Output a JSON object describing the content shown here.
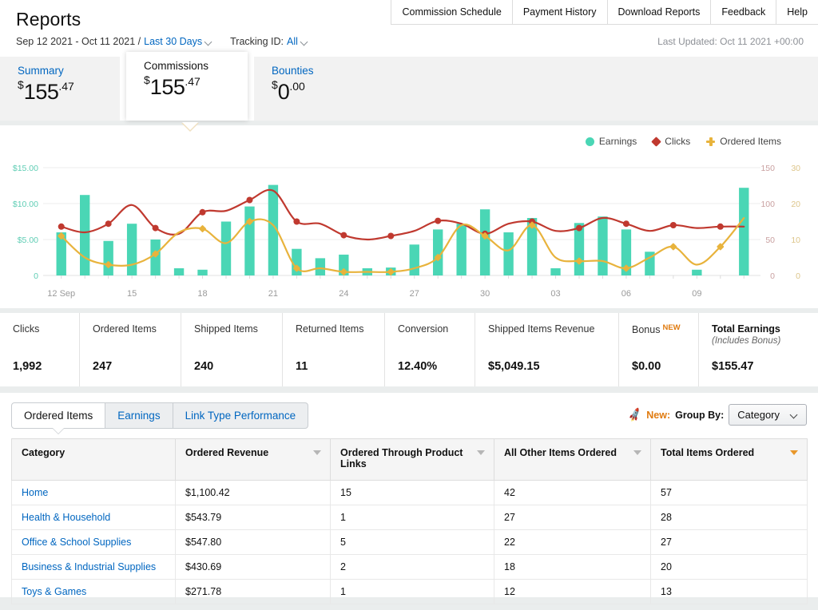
{
  "header": {
    "title": "Reports",
    "date_range": "Sep 12 2021 - Oct 11 2021 /",
    "range_preset": "Last 30 Days",
    "tracking_label": "Tracking ID:",
    "tracking_value": "All",
    "last_updated": "Last Updated: Oct 11 2021 +00:00",
    "nav": [
      {
        "label": "Commission Schedule"
      },
      {
        "label": "Payment History"
      },
      {
        "label": "Download Reports"
      },
      {
        "label": "Feedback"
      },
      {
        "label": "Help"
      }
    ]
  },
  "summary_tabs": [
    {
      "label": "Summary",
      "currency": "$",
      "amount": "155",
      "cents": ".47",
      "active": false
    },
    {
      "label": "Commissions",
      "currency": "$",
      "amount": "155",
      "cents": ".47",
      "active": true
    },
    {
      "label": "Bounties",
      "currency": "$",
      "amount": "0",
      "cents": ".00",
      "active": false
    }
  ],
  "chart_legend": [
    {
      "label": "Earnings",
      "color": "#4ad6b5",
      "marker": "circle"
    },
    {
      "label": "Clicks",
      "color": "#c0392f",
      "marker": "diamond"
    },
    {
      "label": "Ordered Items",
      "color": "#e8b33c",
      "marker": "cross"
    }
  ],
  "chart_data": {
    "type": "bar",
    "title": "",
    "xlabel": "",
    "ylabel": "Earnings",
    "grid": true,
    "legend_position": "top-right",
    "x": [
      "12 Sep",
      "13",
      "14",
      "15",
      "16",
      "17",
      "18",
      "19",
      "20",
      "21",
      "22",
      "23",
      "24",
      "25",
      "26",
      "27",
      "28",
      "29",
      "30",
      "01",
      "02",
      "03",
      "04",
      "05",
      "06",
      "07",
      "08",
      "09",
      "10",
      "11"
    ],
    "tick_labels": [
      "12 Sep",
      "15",
      "18",
      "21",
      "24",
      "27",
      "30",
      "03",
      "06",
      "09"
    ],
    "tick_indices": [
      0,
      3,
      6,
      9,
      12,
      15,
      18,
      21,
      24,
      27
    ],
    "axes": {
      "left": {
        "name": "Earnings",
        "color": "#4ad6b5",
        "ticks": [
          "0",
          "$5.00",
          "$10.00",
          "$15.00"
        ],
        "values": [
          0,
          5,
          10,
          15
        ],
        "ylim": [
          0,
          16
        ]
      },
      "right1": {
        "name": "Clicks",
        "color": "#c0392f",
        "ticks": [
          "0",
          "50",
          "100",
          "150"
        ],
        "values": [
          0,
          50,
          100,
          150
        ],
        "ylim": [
          0,
          160
        ]
      },
      "right2": {
        "name": "Ordered Items",
        "color": "#e8b33c",
        "ticks": [
          "0",
          "10",
          "20",
          "30"
        ],
        "values": [
          0,
          10,
          20,
          30
        ],
        "ylim": [
          0,
          32
        ]
      }
    },
    "series": [
      {
        "name": "Earnings",
        "type": "bar",
        "color": "#4ad6b5",
        "axis": "left",
        "values": [
          6.0,
          11.2,
          4.8,
          7.2,
          5.0,
          1.0,
          0.8,
          7.5,
          9.6,
          12.6,
          3.7,
          2.4,
          2.9,
          1.0,
          1.1,
          4.3,
          6.4,
          7.2,
          9.2,
          6.0,
          8.0,
          1.0,
          7.3,
          8.2,
          6.4,
          3.3,
          0.0,
          0.8,
          0.0,
          12.2
        ]
      },
      {
        "name": "Clicks",
        "type": "line",
        "color": "#c0392f",
        "axis": "right1",
        "values": [
          68,
          60,
          72,
          98,
          66,
          58,
          88,
          90,
          105,
          118,
          75,
          72,
          56,
          50,
          55,
          62,
          76,
          72,
          58,
          72,
          75,
          62,
          66,
          80,
          72,
          62,
          70,
          66,
          68,
          68
        ]
      },
      {
        "name": "Ordered Items",
        "type": "line",
        "color": "#e8b33c",
        "axis": "right2",
        "values": [
          11,
          5,
          3,
          3,
          6,
          12,
          13,
          9,
          15,
          14,
          2,
          2,
          1,
          1,
          1,
          2,
          5,
          14,
          11,
          7,
          14,
          5,
          4,
          4,
          2,
          5,
          8,
          3,
          8,
          16
        ]
      }
    ]
  },
  "metrics": [
    {
      "label": "Clicks",
      "value": "1,992"
    },
    {
      "label": "Ordered Items",
      "value": "247"
    },
    {
      "label": "Shipped Items",
      "value": "240"
    },
    {
      "label": "Returned Items",
      "value": "11"
    },
    {
      "label": "Conversion",
      "value": "12.40%"
    },
    {
      "label": "Shipped Items Revenue",
      "value": "$5,049.15"
    },
    {
      "label": "Bonus",
      "badge": "NEW",
      "value": "$0.00"
    },
    {
      "label": "Total Earnings",
      "sublabel": "(Includes Bonus)",
      "value": "$155.47",
      "bold": true
    }
  ],
  "report_tabs": [
    {
      "label": "Ordered Items",
      "active": true
    },
    {
      "label": "Earnings",
      "active": false
    },
    {
      "label": "Link Type Performance",
      "active": false
    }
  ],
  "groupby": {
    "new_label": "New:",
    "label": "Group By:",
    "selected": "Category"
  },
  "table": {
    "columns": [
      {
        "label": "Category",
        "sorted": false,
        "has_arrow": false
      },
      {
        "label": "Ordered Revenue",
        "sorted": false,
        "has_arrow": true
      },
      {
        "label": "Ordered Through Product Links",
        "sorted": false,
        "has_arrow": true
      },
      {
        "label": "All Other Items Ordered",
        "sorted": false,
        "has_arrow": true
      },
      {
        "label": "Total Items Ordered",
        "sorted": true,
        "has_arrow": true
      }
    ],
    "rows": [
      {
        "category": "Home",
        "ordered_revenue": "$1,100.42",
        "through_links": "15",
        "all_other": "42",
        "total": "57"
      },
      {
        "category": "Health & Household",
        "ordered_revenue": "$543.79",
        "through_links": "1",
        "all_other": "27",
        "total": "28"
      },
      {
        "category": "Office & School Supplies",
        "ordered_revenue": "$547.80",
        "through_links": "5",
        "all_other": "22",
        "total": "27"
      },
      {
        "category": "Business & Industrial Supplies",
        "ordered_revenue": "$430.69",
        "through_links": "2",
        "all_other": "18",
        "total": "20"
      },
      {
        "category": "Toys & Games",
        "ordered_revenue": "$271.78",
        "through_links": "1",
        "all_other": "12",
        "total": "13"
      }
    ]
  }
}
